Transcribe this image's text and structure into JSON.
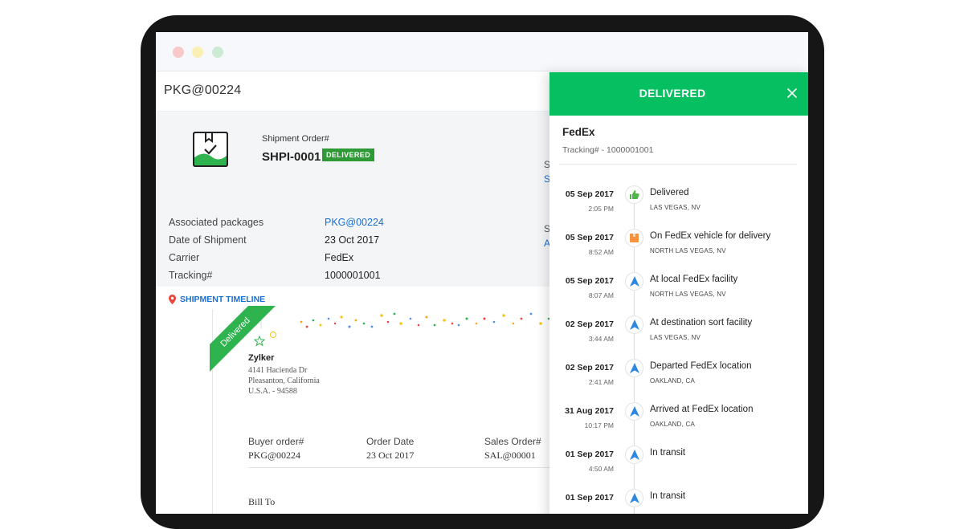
{
  "window": {
    "title": "PKG@00224"
  },
  "shipment": {
    "order_label": "Shipment Order#",
    "order_number": "SHPI-0001",
    "badge": "DELIVERED",
    "details": [
      {
        "label": "Associated packages",
        "value": "PKG@00224"
      },
      {
        "label": "Date of Shipment",
        "value": "23 Oct 2017"
      },
      {
        "label": "Carrier",
        "value": "FedEx"
      },
      {
        "label": "Tracking#",
        "value": "1000001001"
      }
    ],
    "timeline_link": "SHIPMENT TIMELINE",
    "side_fragments": [
      "S",
      "S",
      "S",
      "A"
    ]
  },
  "document": {
    "ribbon": "Delivered",
    "company": "Zylker",
    "address": [
      "4141 Hacienda Dr",
      "Pleasanton, California",
      "U.S.A. - 94588"
    ],
    "headers": [
      "Buyer order#",
      "Order Date",
      "Sales Order#"
    ],
    "values": [
      "PKG@00224",
      "23 Oct 2017",
      "SAL@00001"
    ],
    "bill_to": "Bill To"
  },
  "panel": {
    "title": "DELIVERED",
    "carrier": "FedEx",
    "tracking": "Tracking# - 1000001001",
    "accent": "#05bf60",
    "events": [
      {
        "date": "05 Sep 2017",
        "time": "2:05 PM",
        "status": "Delivered",
        "location": "LAS VEGAS, NV",
        "icon": "thumbs-up-icon"
      },
      {
        "date": "05 Sep 2017",
        "time": "8:52 AM",
        "status": "On FedEx vehicle for delivery",
        "location": "NORTH LAS VEGAS, NV",
        "icon": "package-icon"
      },
      {
        "date": "05 Sep 2017",
        "time": "8:07 AM",
        "status": "At local FedEx facility",
        "location": "NORTH LAS VEGAS, NV",
        "icon": "navigation-arrow-icon"
      },
      {
        "date": "02 Sep 2017",
        "time": "3:44 AM",
        "status": "At destination sort facility",
        "location": "LAS VEGAS, NV",
        "icon": "navigation-arrow-icon"
      },
      {
        "date": "02 Sep 2017",
        "time": "2:41 AM",
        "status": "Departed FedEx location",
        "location": "OAKLAND, CA",
        "icon": "navigation-arrow-icon"
      },
      {
        "date": "31 Aug 2017",
        "time": "10:17 PM",
        "status": "Arrived at FedEx location",
        "location": "OAKLAND, CA",
        "icon": "navigation-arrow-icon"
      },
      {
        "date": "01 Sep 2017",
        "time": "4:50 AM",
        "status": "In transit",
        "location": "",
        "icon": "navigation-arrow-icon"
      },
      {
        "date": "01 Sep 2017",
        "time": "",
        "status": "In transit",
        "location": "",
        "icon": "navigation-arrow-icon"
      }
    ]
  }
}
